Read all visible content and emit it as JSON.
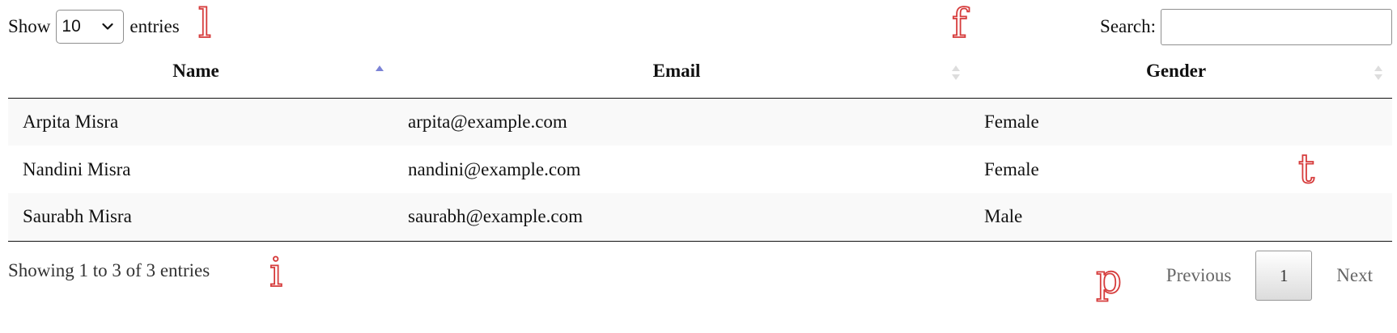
{
  "length_control": {
    "prefix": "Show",
    "selected": "10",
    "suffix": "entries",
    "marker": "l"
  },
  "search": {
    "marker": "f",
    "label": "Search:",
    "value": ""
  },
  "table": {
    "marker": "t",
    "columns": [
      "Name",
      "Email",
      "Gender"
    ],
    "rows": [
      [
        "Arpita Misra",
        "arpita@example.com",
        "Female"
      ],
      [
        "Nandini Misra",
        "nandini@example.com",
        "Female"
      ],
      [
        "Saurabh Misra",
        "saurabh@example.com",
        "Male"
      ]
    ]
  },
  "info": {
    "text": "Showing 1 to 3 of 3 entries",
    "marker": "i"
  },
  "pagination": {
    "marker": "p",
    "previous": "Previous",
    "current": "1",
    "next": "Next"
  },
  "colors": {
    "marker": "#d63c3c",
    "sort_active": "#7b83d6",
    "sort_inactive": "#dddddd",
    "striped_row": "#f9f9f9"
  },
  "icons": {
    "dropdown": "chevron-down-icon",
    "sort_asc": "sort-asc-icon",
    "sort_both": "sort-both-icon"
  }
}
